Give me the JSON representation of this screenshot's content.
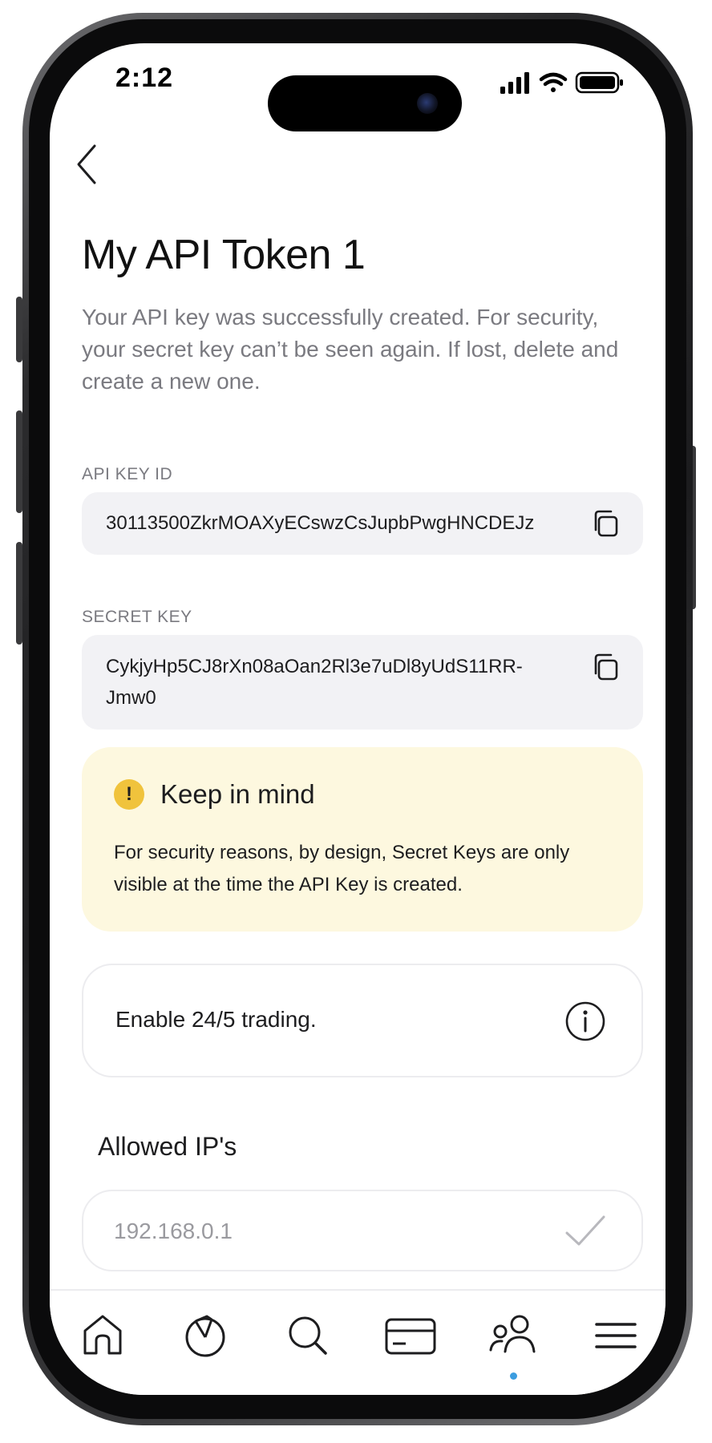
{
  "status_bar": {
    "time": "2:12"
  },
  "page": {
    "title": "My API Token 1",
    "description": "Your API key was successfully created. For security, your secret key can’t be seen again. If lost, delete and create a new one."
  },
  "api_key": {
    "label": "API KEY ID",
    "value": "30113500ZkrMOAXyECswzCsJupbPwgHNCDEJz"
  },
  "secret_key": {
    "label": "SECRET KEY",
    "value_line1": "CykjyHp5CJ8rXn08aOan2Rl3e7uDl8yUdS11RR-",
    "value_line2": "Jmw0"
  },
  "notice": {
    "title": "Keep in mind",
    "icon_glyph": "!",
    "text": "For security reasons, by design, Secret Keys are only visible at the time the API Key is created."
  },
  "trading_toggle": {
    "label": "Enable 24/5 trading."
  },
  "allowed_ips": {
    "heading": "Allowed IP's",
    "placeholder": "192.168.0.1"
  },
  "tab_bar": {
    "items": [
      "home-icon",
      "portfolio-icon",
      "search-icon",
      "card-icon",
      "people-icon",
      "menu-icon"
    ],
    "active": "people-icon"
  },
  "colors": {
    "notice_bg": "#fdf8df",
    "notice_icon": "#f0c33c",
    "active_dot": "#3b9de0",
    "field_bg": "#f2f2f5",
    "muted_text": "#7a7a80"
  }
}
